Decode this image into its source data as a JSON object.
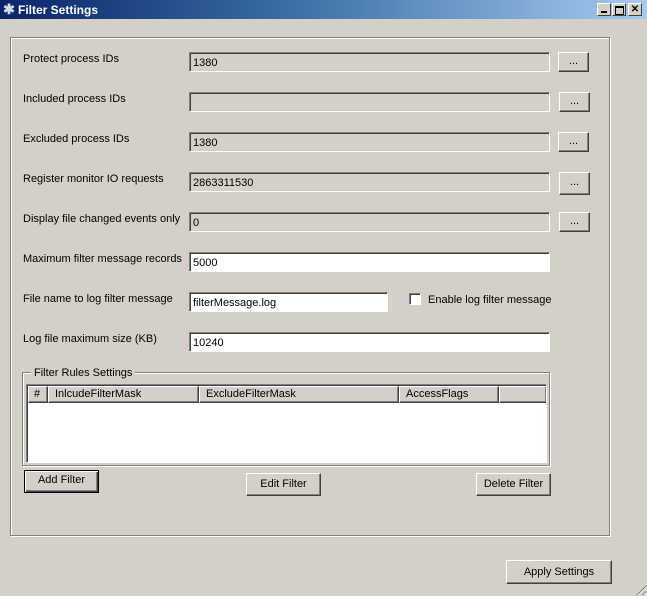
{
  "window": {
    "title": "Filter Settings",
    "icon": "gear-icon",
    "controls": {
      "minimize": "minimize",
      "maximize": "maximize",
      "close": "close"
    }
  },
  "fields": {
    "protect_pids": {
      "label": "Protect process IDs",
      "value": "1380",
      "button": "..."
    },
    "included_pids": {
      "label": "Included process IDs",
      "value": "",
      "button": "..."
    },
    "excluded_pids": {
      "label": "Excluded process IDs",
      "value": "1380",
      "button": "..."
    },
    "register_io": {
      "label": "Register monitor IO requests",
      "value": "2863311530",
      "button": "..."
    },
    "display_changed": {
      "label": "Display file changed events only",
      "value": "0",
      "button": "..."
    },
    "max_records": {
      "label": "Maximum filter message records",
      "value": "5000"
    },
    "log_file_name": {
      "label": "File name to log filter message",
      "value": "filterMessage.log"
    },
    "enable_log": {
      "label": "Enable log filter message",
      "checked": false
    },
    "log_max_size": {
      "label": "Log file maximum size (KB)",
      "value": "10240"
    }
  },
  "filter_rules": {
    "legend": "Filter Rules Settings",
    "columns": [
      "#",
      "InlcudeFilterMask",
      "ExcludeFilterMask",
      "AccessFlags",
      ""
    ],
    "rows": [],
    "buttons": {
      "add": "Add Filter",
      "edit": "Edit Filter",
      "delete": "Delete Filter"
    }
  },
  "footer": {
    "apply": "Apply Settings"
  }
}
